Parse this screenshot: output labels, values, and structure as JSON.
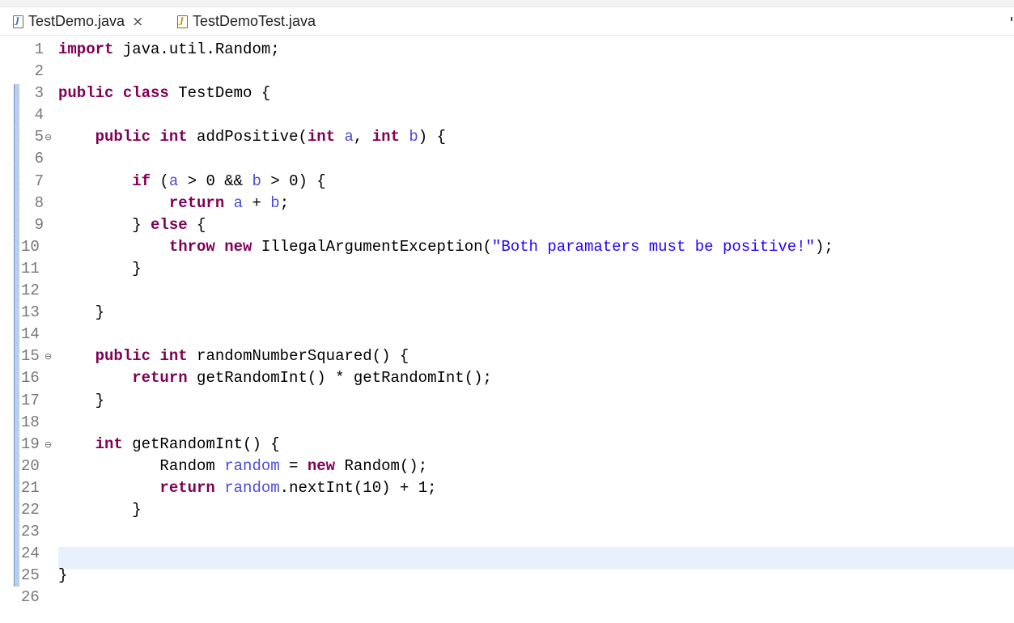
{
  "tabs": [
    {
      "label": "TestDemo.java",
      "icon": "java-file-icon",
      "active": true
    },
    {
      "label": "TestDemoTest.java",
      "icon": "java-test-file-icon",
      "active": false
    }
  ],
  "close_glyph": "×",
  "code_lines": [
    {
      "num": "1",
      "text": "import java.util.Random;"
    },
    {
      "num": "2",
      "text": ""
    },
    {
      "num": "3",
      "text": "public class TestDemo {"
    },
    {
      "num": "4",
      "text": ""
    },
    {
      "num": "5",
      "text": "    public int addPositive(int a, int b) {",
      "fold": true
    },
    {
      "num": "6",
      "text": ""
    },
    {
      "num": "7",
      "text": "        if (a > 0 && b > 0) {"
    },
    {
      "num": "8",
      "text": "            return a + b;"
    },
    {
      "num": "9",
      "text": "        } else {"
    },
    {
      "num": "10",
      "text": "            throw new IllegalArgumentException(\"Both paramaters must be positive!\");"
    },
    {
      "num": "11",
      "text": "        }"
    },
    {
      "num": "12",
      "text": ""
    },
    {
      "num": "13",
      "text": "    }"
    },
    {
      "num": "14",
      "text": ""
    },
    {
      "num": "15",
      "text": "    public int randomNumberSquared() {",
      "fold": true
    },
    {
      "num": "16",
      "text": "        return getRandomInt() * getRandomInt();"
    },
    {
      "num": "17",
      "text": "    }"
    },
    {
      "num": "18",
      "text": ""
    },
    {
      "num": "19",
      "text": "    int getRandomInt() {",
      "fold": true
    },
    {
      "num": "20",
      "text": "           Random random = new Random();"
    },
    {
      "num": "21",
      "text": "           return random.nextInt(10) + 1;"
    },
    {
      "num": "22",
      "text": "        }"
    },
    {
      "num": "23",
      "text": ""
    },
    {
      "num": "24",
      "text": "",
      "current": true
    },
    {
      "num": "25",
      "text": "}"
    },
    {
      "num": "26",
      "text": ""
    }
  ],
  "colors": {
    "keyword": "#7f0055",
    "variable": "#4b4bd6",
    "string": "#2a00ff",
    "line_number": "#787878",
    "current_line": "#e8f1fb"
  }
}
